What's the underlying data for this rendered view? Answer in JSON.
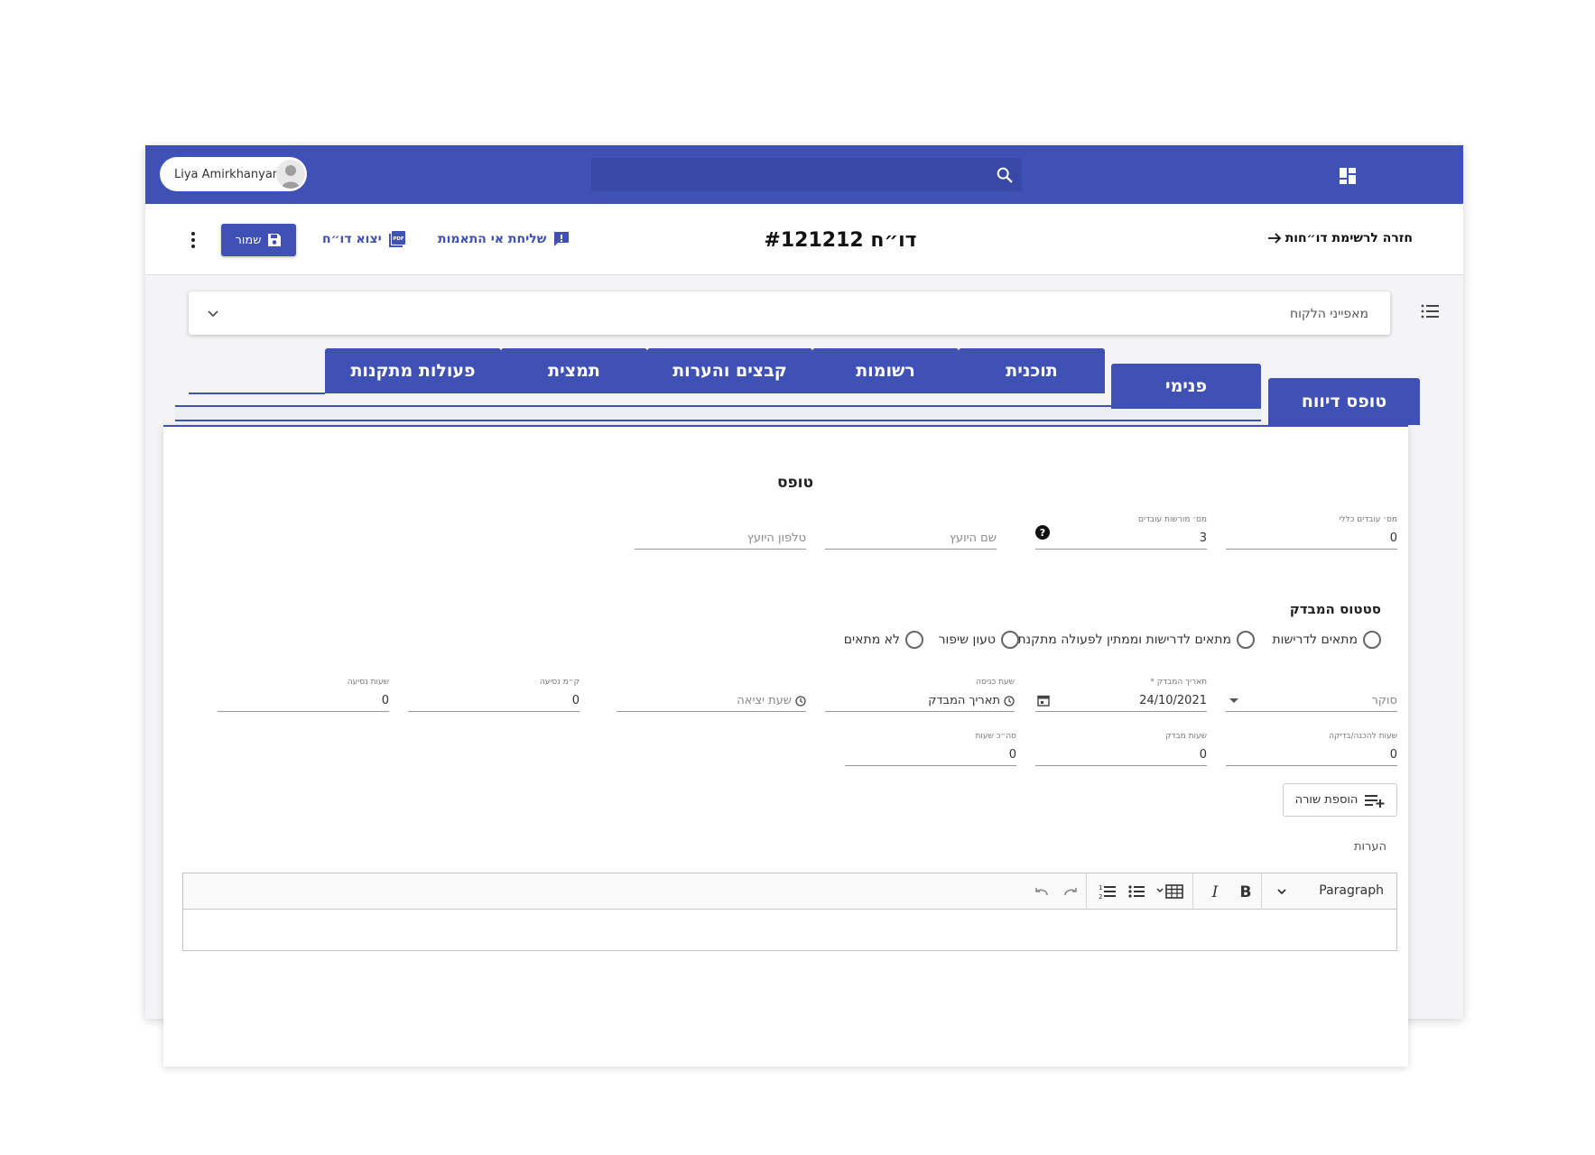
{
  "topbar": {
    "user_name": "Liya Amirkhanyan",
    "search_placeholder": ""
  },
  "actionbar": {
    "title": "דו״ח #121212",
    "back_label": "חזרה לרשימת דו״חות",
    "save_label": "שמור",
    "export_label": "יצוא דו״ח",
    "mismatch_label": "שליחת אי התאמות",
    "pdf_badge": "PDF"
  },
  "accordion": {
    "label": "מאפייני הלקוח"
  },
  "tabs": {
    "main": "טופס דיווח",
    "inner": "פנימי",
    "items": [
      "תוכנית",
      "רשומות",
      "קבצים והערות",
      "תמצית",
      "פעולות מתקנות"
    ]
  },
  "form": {
    "title": "טופס",
    "fields_row1": [
      {
        "label": "מס׳ עובדים כללי",
        "value": "0"
      },
      {
        "label": "מס׳ מורשות עובדים",
        "value": "3"
      },
      {
        "label": "",
        "placeholder": "שם היועץ"
      },
      {
        "label": "",
        "placeholder": "טלפון היועץ"
      }
    ],
    "status_title": "סטטוס המבדק",
    "status_options": [
      "מתאים לדרישות",
      "מתאים לדרישות וממתין לפעולה מתקנת",
      "טעון שיפור",
      "לא מתאים"
    ],
    "fields_row2": [
      {
        "label": "",
        "placeholder": "סוקר"
      },
      {
        "label": "תאריך המבדק *",
        "value": "24/10/2021"
      },
      {
        "label": "שעת כניסה",
        "value": "תאריך המבדק"
      },
      {
        "label": "",
        "placeholder": "שעת יציאה"
      },
      {
        "label": "ק״מ נסיעה",
        "value": "0"
      },
      {
        "label": "שעות נסיעה",
        "value": "0"
      }
    ],
    "fields_row3": [
      {
        "label": "שעות להכנה/בדיקה",
        "value": "0"
      },
      {
        "label": "שעות מבדק",
        "value": "0"
      },
      {
        "label": "סה״כ שעות",
        "value": "0"
      }
    ],
    "add_row_label": "הוספת שורה",
    "notes_label": "הערות",
    "editor": {
      "paragraph_label": "Paragraph"
    }
  },
  "colors": {
    "primary": "#3f51b5",
    "primary_dark": "#3948a6"
  }
}
